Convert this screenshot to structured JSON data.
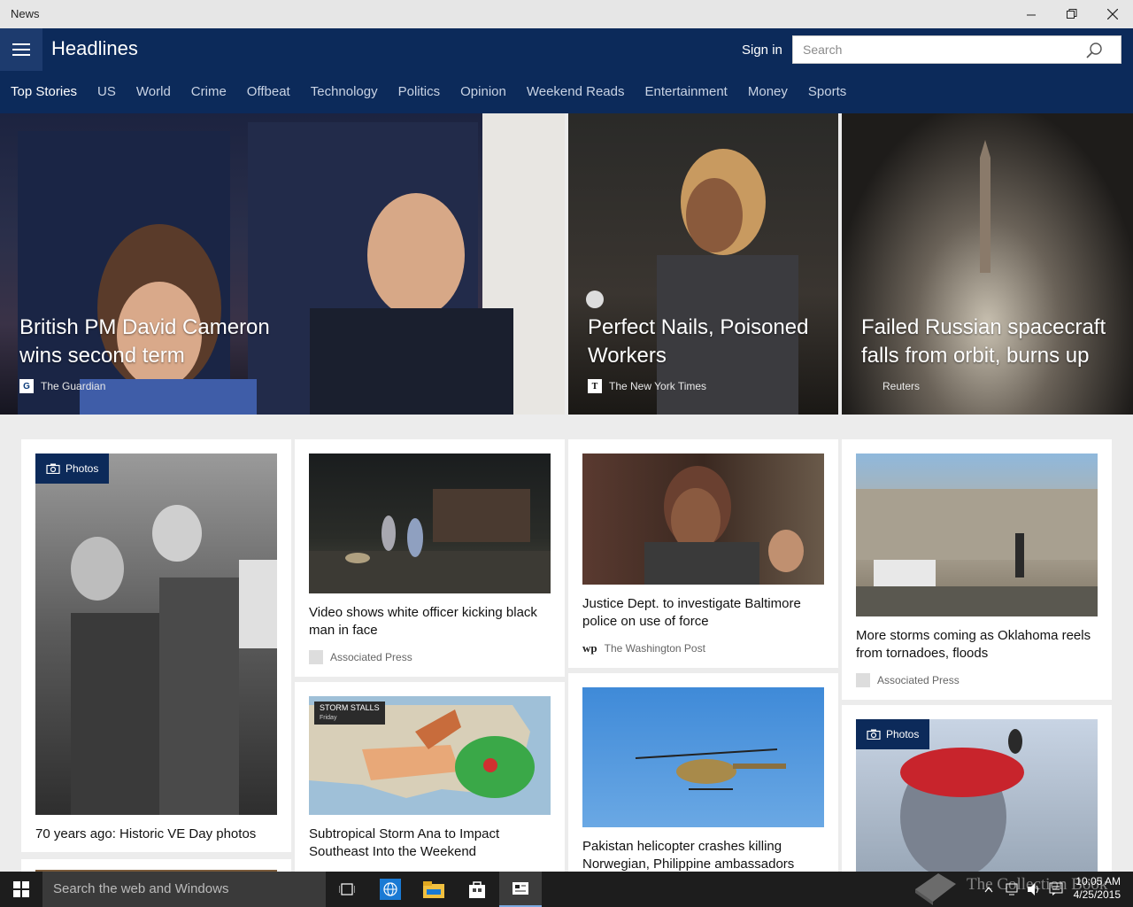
{
  "window": {
    "title": "News"
  },
  "header": {
    "section": "Headlines",
    "signin": "Sign in",
    "search_placeholder": "Search"
  },
  "nav": {
    "tabs": [
      "Top Stories",
      "US",
      "World",
      "Crime",
      "Offbeat",
      "Technology",
      "Politics",
      "Opinion",
      "Weekend Reads",
      "Entertainment",
      "Money",
      "Sports"
    ],
    "active": "Top Stories"
  },
  "hero": [
    {
      "title": "British PM David Cameron wins second term",
      "source": "The Guardian"
    },
    {
      "title": "Perfect Nails, Poisoned Workers",
      "source": "The New York Times"
    },
    {
      "title": "Failed Russian spacecraft falls from orbit, burns up",
      "source": "Reuters"
    }
  ],
  "cards": [
    {
      "badge": "Photos",
      "title": "70 years ago: Historic VE Day photos"
    },
    {
      "title": "Video shows white officer kicking black man in face",
      "source": "Associated Press"
    },
    {
      "title": "Justice Dept. to investigate Baltimore police on use of force",
      "source": "The Washington Post"
    },
    {
      "title": "More storms coming as Oklahoma reels from tornadoes, floods",
      "source": "Associated Press"
    },
    {
      "title": "Subtropical Storm Ana to Impact Southeast Into the Weekend",
      "map_label": "STORM STALLS",
      "map_sublabel": "Friday"
    },
    {
      "title": "Pakistan helicopter crashes killing Norwegian, Philippine ambassadors"
    },
    {
      "badge": "Photos"
    }
  ],
  "taskbar": {
    "search_placeholder": "Search the web and Windows",
    "time": "10:05 AM",
    "date": "4/25/2015",
    "watermark": "The Collection Book"
  },
  "colors": {
    "header_bg": "#0c2a5a",
    "accent": "#1d3b6e"
  }
}
